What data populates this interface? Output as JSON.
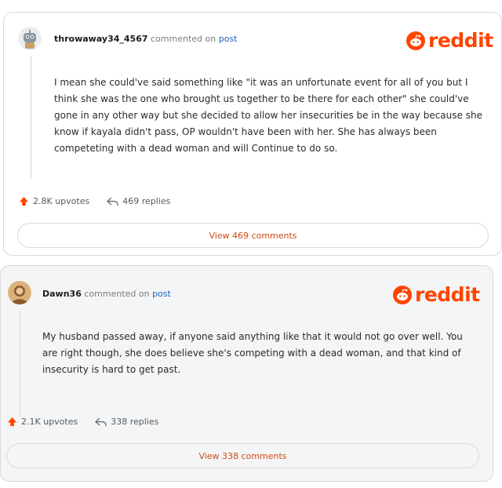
{
  "comments": [
    {
      "username": "throwaway34_4567",
      "action": "commented on",
      "link": "post",
      "brand": "reddit",
      "body": "I mean she could've said something like \"it was an unfortunate event for all of you but I think she was the one who brought us together to be there for each other\" she could've gone in any other way but she decided to allow her insecurities be in the way because she know if kayala didn't pass, OP wouldn't have been with her. She has always been competeting with a dead woman and will Continue to do so.",
      "upvotes": "2.8K upvotes",
      "replies": "469 replies",
      "view_button": "View 469 comments"
    },
    {
      "username": "Dawn36",
      "action": "commented on",
      "link": "post",
      "brand": "reddit",
      "body": "My husband passed away, if anyone said anything like that it would not go over well. You are right though, she does believe she's competing with a dead woman, and that kind of insecurity is hard to get past.",
      "upvotes": "2.1K upvotes",
      "replies": "338 replies",
      "view_button": "View 338 comments"
    }
  ],
  "colors": {
    "brand": "#ff4500",
    "upvote": "#ff4500",
    "link": "#1e5fb8",
    "view": "#d04a12"
  }
}
